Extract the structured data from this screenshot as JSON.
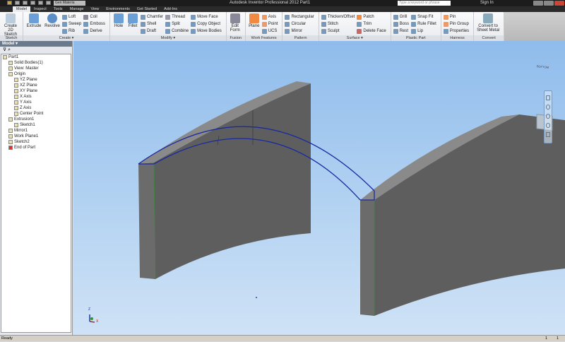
{
  "window": {
    "title": "Autodesk Inventor Professional 2012   Part1",
    "search_placeholder": "Type a keyword or phrase",
    "sign_in": "Sign In",
    "material": "Gen Materia"
  },
  "tabs": [
    "Model",
    "Inspect",
    "Tools",
    "Manage",
    "View",
    "Environments",
    "Get Started",
    "Add-Ins"
  ],
  "ribbon": {
    "sketch": {
      "label": "Sketch",
      "create_2d": "Create 2D Sketch"
    },
    "create": {
      "label": "Create ▾",
      "extrude": "Extrude",
      "revolve": "Revolve",
      "loft": "Loft",
      "sweep": "Sweep",
      "rib": "Rib",
      "coil": "Coil",
      "emboss": "Emboss",
      "derive": "Derive"
    },
    "modify": {
      "label": "Modify ▾",
      "hole": "Hole",
      "fillet": "Fillet",
      "chamfer": "Chamfer",
      "shell": "Shell",
      "draft": "Draft",
      "thread": "Thread",
      "split": "Split",
      "combine": "Combine",
      "move_face": "Move Face",
      "copy_object": "Copy Object",
      "move_bodies": "Move Bodies"
    },
    "fusion": {
      "label": "Fusion",
      "edit_form": "Edit Form"
    },
    "work_features": {
      "label": "Work Features",
      "plane": "Plane",
      "axis": "Axis",
      "point": "Point",
      "ucs": "UCS"
    },
    "pattern": {
      "label": "Pattern",
      "rectangular": "Rectangular",
      "circular": "Circular",
      "mirror": "Mirror"
    },
    "surface": {
      "label": "Surface ▾",
      "thicken": "Thicken/Offset",
      "stitch": "Stitch",
      "sculpt": "Sculpt",
      "patch": "Patch",
      "trim": "Trim",
      "delete_face": "Delete Face"
    },
    "plastic_part": {
      "label": "Plastic Part",
      "grill": "Grill",
      "boss": "Boss",
      "rest": "Rest",
      "snap_fit": "Snap Fit",
      "rule_fillet": "Rule Fillet",
      "lip": "Lip"
    },
    "harness": {
      "label": "Harness",
      "pin": "Pin",
      "pin_group": "Pin Group",
      "properties": "Properties"
    },
    "convert": {
      "label": "Convert",
      "to_sheet_metal": "Convert to Sheet Metal"
    }
  },
  "browser": {
    "title": "Model ▾",
    "tree": [
      {
        "label": "Part1",
        "level": 0
      },
      {
        "label": "Solid Bodies(1)",
        "level": 1
      },
      {
        "label": "View: Master",
        "level": 1
      },
      {
        "label": "Origin",
        "level": 1
      },
      {
        "label": "YZ Plane",
        "level": 2
      },
      {
        "label": "XZ Plane",
        "level": 2
      },
      {
        "label": "XY Plane",
        "level": 2
      },
      {
        "label": "X Axis",
        "level": 2
      },
      {
        "label": "Y Axis",
        "level": 2
      },
      {
        "label": "Z Axis",
        "level": 2
      },
      {
        "label": "Center Point",
        "level": 2
      },
      {
        "label": "Extrusion1",
        "level": 1
      },
      {
        "label": "Sketch1",
        "level": 2
      },
      {
        "label": "Mirror1",
        "level": 1
      },
      {
        "label": "Work Plane1",
        "level": 1
      },
      {
        "label": "Sketch2",
        "level": 1
      },
      {
        "label": "End of Part",
        "level": 1
      }
    ]
  },
  "viewcube": {
    "face": "BOTTOM"
  },
  "triad": {
    "z": "Z",
    "x": "X"
  },
  "status": {
    "text": "Ready",
    "count1": "1",
    "count2": "1"
  }
}
